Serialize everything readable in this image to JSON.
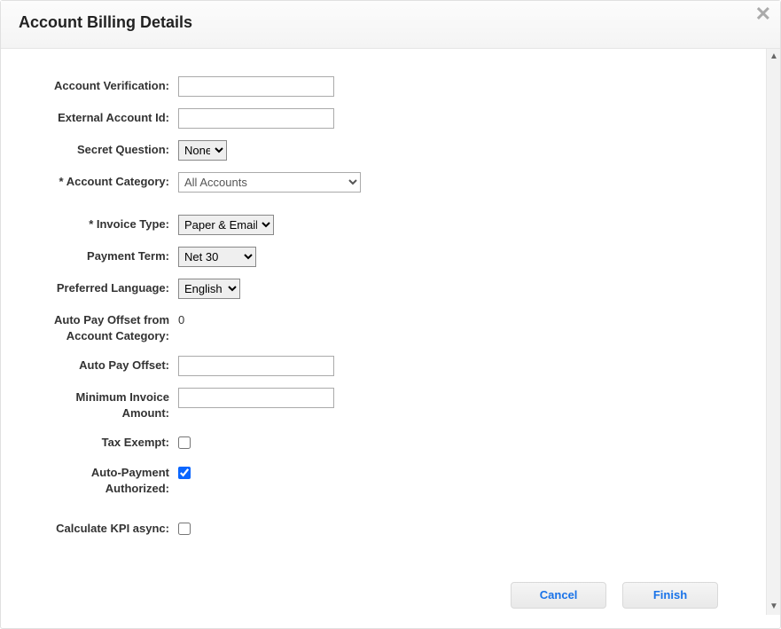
{
  "header": {
    "title": "Account Billing Details"
  },
  "form": {
    "account_verification": {
      "label": "Account Verification:",
      "value": ""
    },
    "external_account_id": {
      "label": "External Account Id:",
      "value": ""
    },
    "secret_question": {
      "label": "Secret Question:",
      "selected": "None"
    },
    "account_category": {
      "label": "* Account Category:",
      "selected": "All Accounts"
    },
    "invoice_type": {
      "label": "* Invoice Type:",
      "selected": "Paper & Email"
    },
    "payment_term": {
      "label": "Payment Term:",
      "selected": "Net 30"
    },
    "preferred_language": {
      "label": "Preferred Language:",
      "selected": "English"
    },
    "auto_pay_offset_category": {
      "label": "Auto Pay Offset from Account Category:",
      "value": "0"
    },
    "auto_pay_offset": {
      "label": "Auto Pay Offset:",
      "value": ""
    },
    "min_invoice_amount": {
      "label": "Minimum Invoice Amount:",
      "value": ""
    },
    "tax_exempt": {
      "label": "Tax Exempt:",
      "checked": false
    },
    "auto_payment_authorized": {
      "label": "Auto-Payment Authorized:",
      "checked": true
    },
    "calculate_kpi_async": {
      "label": "Calculate KPI async:",
      "checked": false
    }
  },
  "buttons": {
    "cancel": "Cancel",
    "finish": "Finish"
  }
}
